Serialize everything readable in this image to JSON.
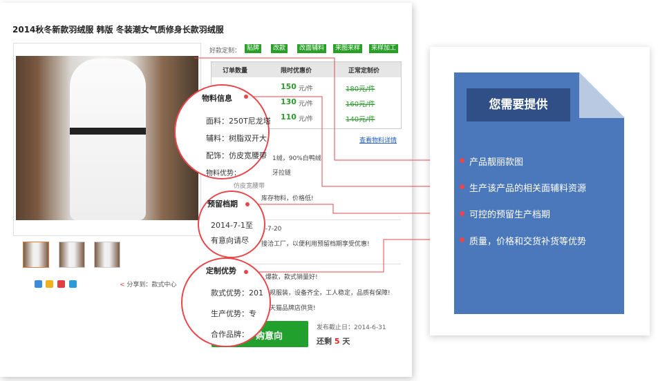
{
  "product": {
    "title": "2014秋冬新款羽绒服 韩版 冬装潮女气质修身长款羽绒服",
    "share_label": "分享到：款式中心",
    "custom_label": "好款定制：",
    "custom_buttons": [
      "贴牌",
      "改款",
      "改面辅料",
      "来图来样",
      "来样加工"
    ],
    "view_materials": "查看物料详情",
    "table": {
      "headers": [
        "订单数量",
        "限时优惠价",
        "正常定制价"
      ],
      "rows": [
        {
          "price": "150",
          "unit": "元/件",
          "normal": "180元/件"
        },
        {
          "price": "130",
          "unit": "元/件",
          "normal": "160元/件"
        },
        {
          "price": "110",
          "unit": "元/件",
          "normal": "140元/件"
        }
      ]
    },
    "partial_texts": {
      "down": "1绒，90%白鸭绒",
      "zipper": "牙拉链",
      "trim": "仿皮宽腰带",
      "stock": "库存物料，价格低!",
      "date_end": "4-7-20",
      "factory": "接洽工厂，以便利用预留档期享受优惠!",
      "hot": "爆款，款式销量好!",
      "equip": "规服装，设备齐全，工人稳定，品质有保障!",
      "tmall": "天猫品牌店供货!"
    },
    "buy_button": "购意向",
    "deadline": "发布截止日：2014-6-31",
    "remain_prefix": "还剩",
    "remain_days": "5",
    "remain_suffix": "天"
  },
  "circles": {
    "materials": {
      "title": "物料信息",
      "lines": [
        "面料：250T尼龙塔",
        "辅料：树脂双开大",
        "配饰：仿皮宽腰带",
        "物料优势："
      ]
    },
    "schedule": {
      "title": "预留档期",
      "lines": [
        "2014-7-1至",
        "有意向请尽"
      ]
    },
    "advantage": {
      "title": "定制优势",
      "lines": [
        "款式优势：201",
        "生产优势：专",
        "合作品牌："
      ]
    }
  },
  "panel": {
    "heading": "您需要提供",
    "items": [
      "产品靓丽款图",
      "生产该产品的相关面辅料资源",
      "可控的预留生产档期",
      "质量，价格和交货补货等优势"
    ]
  },
  "colors": {
    "accent_red": "#e8464b",
    "panel_blue": "#4b77bb",
    "heading_blue": "#2f4f86",
    "green": "#28a028"
  }
}
